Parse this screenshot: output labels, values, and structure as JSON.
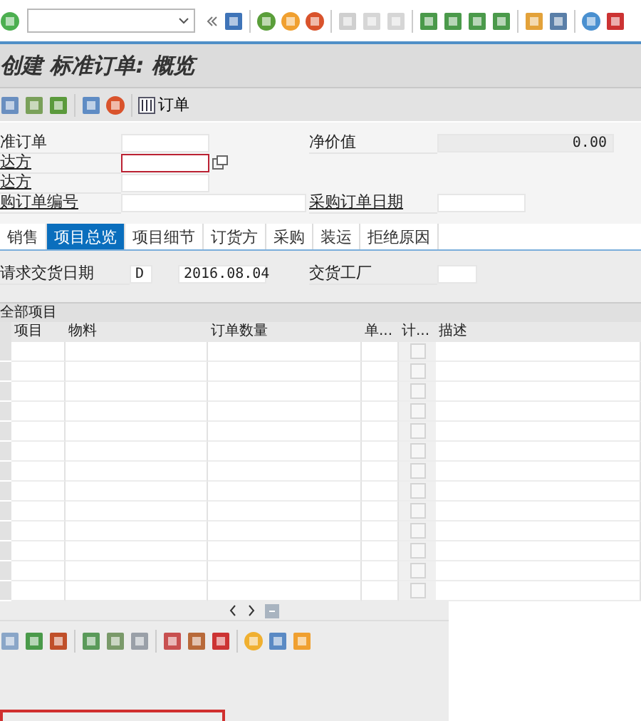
{
  "title": "创建 标准订单: 概览",
  "app_toolbar": {
    "order_button": "订单"
  },
  "header": {
    "rows": [
      {
        "label": "准订单",
        "underlined": false,
        "field": {
          "kind": "short",
          "focused": false
        },
        "right_label": "净价值",
        "right_field": {
          "kind": "readonly",
          "value": "0.00"
        }
      },
      {
        "label": "达方",
        "underlined": true,
        "field": {
          "kind": "short",
          "focused": true
        }
      },
      {
        "label": "达方",
        "underlined": true,
        "field": {
          "kind": "short",
          "focused": false
        }
      },
      {
        "label": "购订单编号",
        "underlined": true,
        "field": {
          "kind": "long",
          "focused": false
        },
        "right_label": "采购订单日期",
        "right_field": {
          "kind": "date"
        }
      }
    ]
  },
  "tabs": [
    {
      "label": "销售",
      "selected": false
    },
    {
      "label": "项目总览",
      "selected": true
    },
    {
      "label": "项目细节",
      "selected": false
    },
    {
      "label": "订货方",
      "selected": false
    },
    {
      "label": "采购",
      "selected": false
    },
    {
      "label": "装运",
      "selected": false
    },
    {
      "label": "拒绝原因",
      "selected": false
    }
  ],
  "tab_panel": {
    "delivery_date_label": "请求交货日期",
    "date_type": "D",
    "delivery_date": "2016.08.04",
    "plant_label": "交货工厂"
  },
  "table": {
    "title": "全部项目",
    "columns": [
      "项目",
      "物料",
      "订单数量",
      "单...",
      "计...",
      "描述"
    ],
    "rows": [
      {
        "checked": false
      },
      {
        "checked": false
      },
      {
        "checked": false
      },
      {
        "checked": false
      },
      {
        "checked": false
      },
      {
        "checked": false
      },
      {
        "checked": false
      },
      {
        "checked": false
      },
      {
        "checked": false
      },
      {
        "checked": false
      },
      {
        "checked": false
      },
      {
        "checked": false
      },
      {
        "checked": false
      }
    ]
  }
}
